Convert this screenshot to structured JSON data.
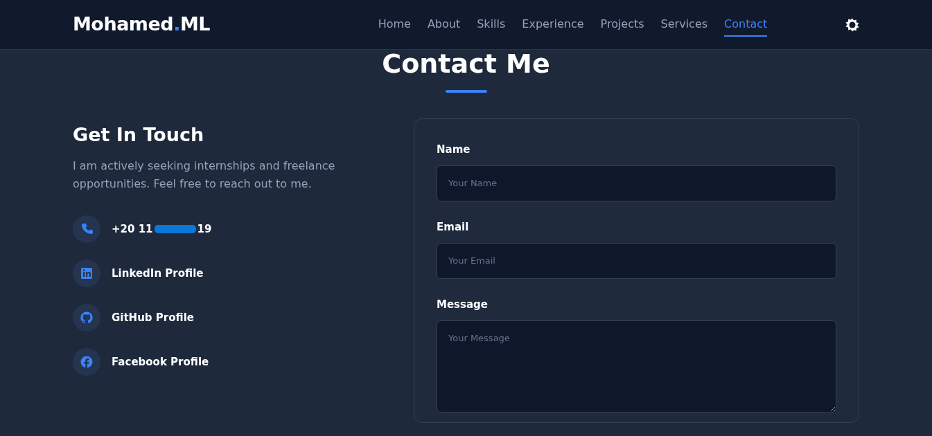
{
  "navbar": {
    "brand": {
      "name": "Mohamed",
      "dot": ".",
      "suffix": "ML"
    },
    "links": [
      {
        "label": "Home",
        "selected": false
      },
      {
        "label": "About",
        "selected": false
      },
      {
        "label": "Skills",
        "selected": false
      },
      {
        "label": "Experience",
        "selected": false
      },
      {
        "label": "Projects",
        "selected": false
      },
      {
        "label": "Services",
        "selected": false
      },
      {
        "label": "Contact",
        "selected": true
      }
    ]
  },
  "section_title": "Contact Me",
  "intro": {
    "heading": "Get In Touch",
    "text": "I am actively seeking internships and freelance opportunities. Feel free to reach out to me."
  },
  "contacts": [
    {
      "kind": "phone",
      "prefix": "+20 11",
      "suffix": "19",
      "redacted": true
    },
    {
      "kind": "linkedin",
      "label": "LinkedIn Profile"
    },
    {
      "kind": "github",
      "label": "GitHub Profile"
    },
    {
      "kind": "facebook",
      "label": "Facebook Profile"
    }
  ],
  "form": {
    "fields": [
      {
        "kind": "input",
        "label": "Name",
        "placeholder": "Your Name"
      },
      {
        "kind": "input",
        "label": "Email",
        "placeholder": "Your Email"
      },
      {
        "kind": "textarea",
        "label": "Message",
        "placeholder": "Your Message"
      }
    ]
  }
}
